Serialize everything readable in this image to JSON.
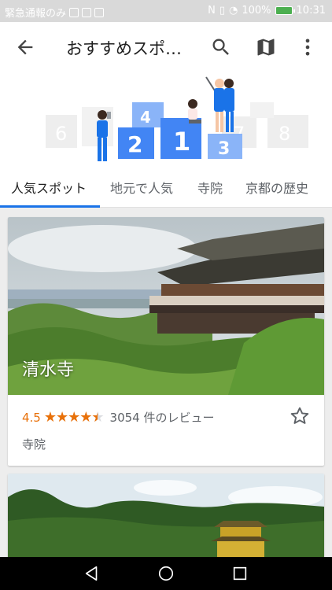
{
  "status_bar": {
    "left_text": "緊急通報のみ",
    "battery": "100%",
    "time": "10:31"
  },
  "app_bar": {
    "title": "おすすめスポ…",
    "icons": [
      "back-arrow-icon",
      "search-icon",
      "map-icon",
      "more-vert-icon"
    ]
  },
  "illustration": {
    "podium_numbers": [
      "1",
      "2",
      "3",
      "4"
    ],
    "bg_numbers": [
      "6",
      "7",
      "8"
    ]
  },
  "tabs": [
    {
      "label": "人気スポット",
      "active": true
    },
    {
      "label": "地元で人気",
      "active": false
    },
    {
      "label": "寺院",
      "active": false
    },
    {
      "label": "京都の歴史",
      "active": false
    }
  ],
  "cards": [
    {
      "title": "清水寺",
      "rating": "4.5",
      "stars": 4.5,
      "reviews": "3054 件のレビュー",
      "category": "寺院"
    },
    {
      "title": "",
      "rating": "",
      "reviews": "",
      "category": ""
    }
  ],
  "colors": {
    "accent": "#1a73e8",
    "rating": "#e8710a",
    "statusbar": "#d9d9d9"
  }
}
